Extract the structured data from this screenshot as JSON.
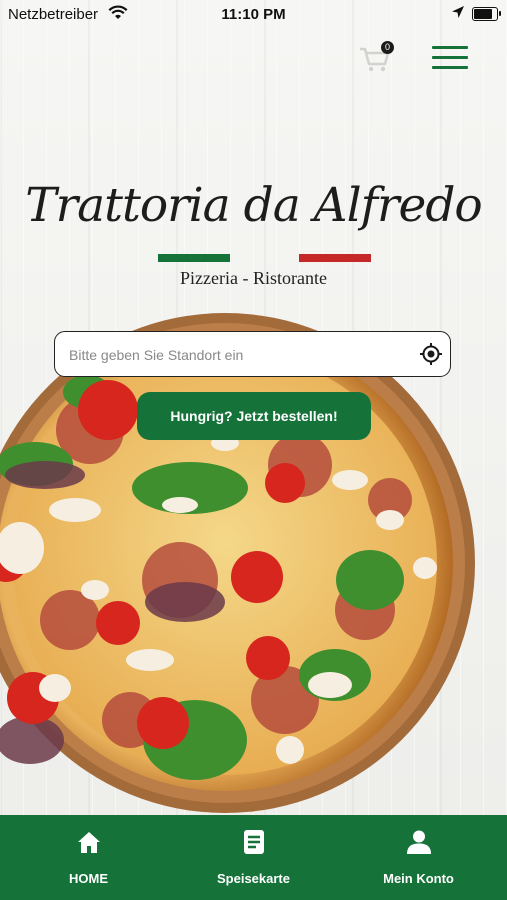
{
  "status_bar": {
    "carrier": "Netzbetreiber",
    "time": "11:10 PM"
  },
  "header": {
    "cart_count": "0",
    "cart_icon": "shopping-cart-icon",
    "menu_icon": "hamburger-menu-icon"
  },
  "brand": {
    "name": "Trattoria da Alfredo",
    "subtitle": "Pizzeria - Ristorante",
    "flag_colors": [
      "#15733a",
      "#c62828"
    ]
  },
  "search": {
    "placeholder": "Bitte geben Sie Standort ein",
    "value": "",
    "icon": "locate-icon"
  },
  "cta": {
    "label": "Hungrig? Jetzt bestellen!"
  },
  "bottom_nav": {
    "items": [
      {
        "label": "HOME",
        "icon": "home-icon"
      },
      {
        "label": "Speisekarte",
        "icon": "menu-card-icon"
      },
      {
        "label": "Mein Konto",
        "icon": "account-icon"
      }
    ]
  },
  "colors": {
    "accent": "#15733a",
    "text": "#1d1d1d"
  }
}
